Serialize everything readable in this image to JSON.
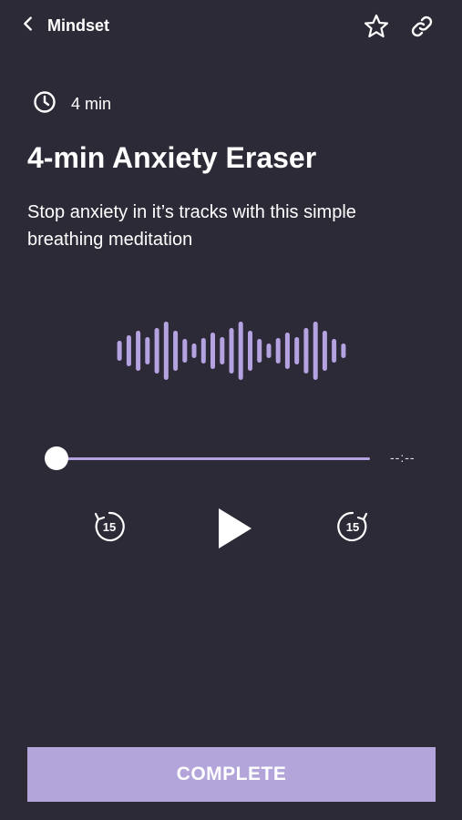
{
  "header": {
    "back_label": "Mindset"
  },
  "session": {
    "duration": "4 min",
    "title": "4-min Anxiety Eraser",
    "description": "Stop anxiety in it’s tracks with this simple breathing meditation"
  },
  "player": {
    "time_display": "--:--",
    "progress": 0,
    "skip_back_seconds": "15",
    "skip_forward_seconds": "15"
  },
  "footer": {
    "complete_label": "COMPLETE"
  },
  "icons": {
    "back": "chevron-left-icon",
    "favorite": "star-icon",
    "share": "link-icon",
    "duration": "clock-icon",
    "rewind": "rewind-15-icon",
    "play": "play-icon",
    "forward": "forward-15-icon"
  },
  "colors": {
    "background": "#2d2a37",
    "accent": "#b5a2e1",
    "button": "#b3a4d9",
    "text": "#ffffff"
  }
}
